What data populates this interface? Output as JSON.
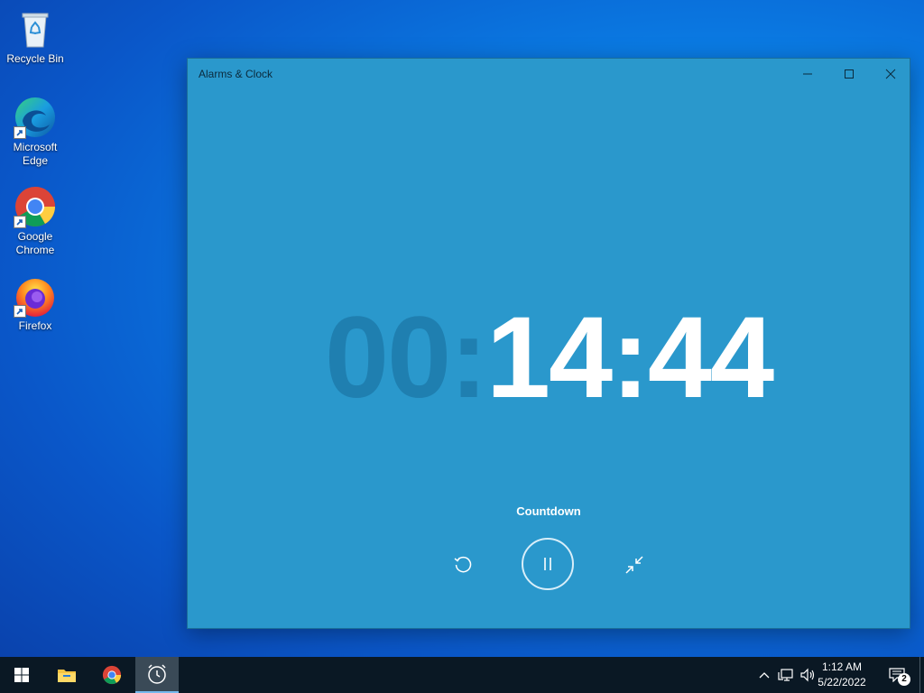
{
  "desktop": {
    "icons": [
      {
        "label": "Recycle Bin"
      },
      {
        "label": "Microsoft Edge"
      },
      {
        "label": "Google Chrome"
      },
      {
        "label": "Firefox"
      }
    ]
  },
  "window": {
    "title": "Alarms & Clock",
    "timer": {
      "dim": "00:",
      "bright": "14:44"
    },
    "mode_label": "Countdown",
    "controls": [
      "reset-icon",
      "pause-icon",
      "collapse-icon"
    ]
  },
  "taskbar": {
    "apps": [
      "start-icon",
      "file-explorer-icon",
      "chrome-icon",
      "alarms-clock-icon"
    ],
    "clock": {
      "time": "1:12 AM",
      "date": "5/22/2022"
    },
    "notifications": {
      "count": "2"
    }
  },
  "colors": {
    "window_bg": "#2a98cc",
    "digits_dim": "#1f7fb0",
    "digits_bright": "#ffffff",
    "taskbar_bg": "#0a1824"
  }
}
